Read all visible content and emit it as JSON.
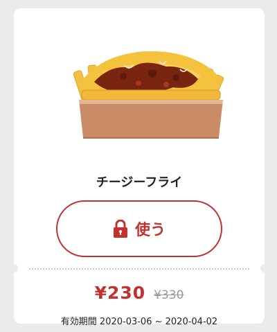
{
  "coupon": {
    "product_name": "チージーフライ",
    "use_button_label": "使う",
    "lock_icon": "lock-icon",
    "price": "¥230",
    "original_price": "¥330",
    "validity": "有効期間 2020-03-06 ~ 2020-04-02"
  },
  "colors": {
    "accent": "#c33030",
    "background": "#ecebeb",
    "card": "#ffffff",
    "muted": "#999999"
  }
}
